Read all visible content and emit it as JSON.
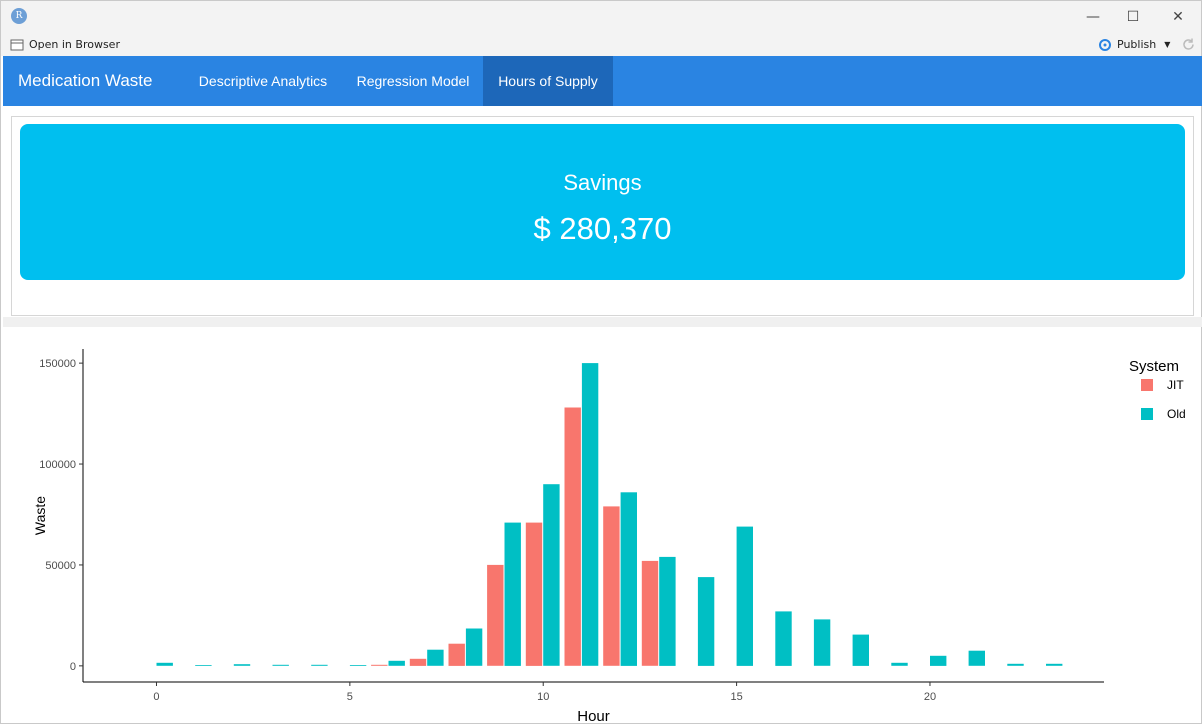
{
  "window": {
    "app_icon": "R",
    "controls": {
      "minimize": "—",
      "maximize": "☐",
      "close": "✕"
    }
  },
  "toolbar": {
    "open_in_browser": "Open in Browser",
    "publish": "Publish"
  },
  "navbar": {
    "brand": "Medication Waste",
    "tabs": [
      {
        "label": "Descriptive Analytics",
        "active": false
      },
      {
        "label": "Regression Model",
        "active": false
      },
      {
        "label": "Hours of Supply",
        "active": true
      }
    ]
  },
  "valuebox": {
    "title": "Savings",
    "value": "$ 280,370",
    "color": "#00bfef"
  },
  "colors": {
    "navbar": "#2a84e2",
    "active_tab": "#1d67b9",
    "jit": "#f8766d",
    "old": "#00bfc4"
  },
  "chart_data": {
    "type": "bar",
    "xlabel": "Hour",
    "ylabel": "Waste",
    "xlim": [
      -1.9,
      24.5
    ],
    "ylim": [
      -8000,
      157000
    ],
    "xticks": [
      0,
      5,
      10,
      15,
      20
    ],
    "yticks": [
      0,
      50000,
      100000,
      150000
    ],
    "ytick_labels": [
      "0",
      "50000",
      "100000",
      "150000"
    ],
    "legend": {
      "title": "System",
      "placement": "right"
    },
    "x": [
      0,
      1,
      2,
      3,
      4,
      5,
      6,
      7,
      8,
      9,
      10,
      11,
      12,
      13,
      14,
      15,
      16,
      17,
      18,
      19,
      20,
      21,
      22,
      23
    ],
    "series": [
      {
        "name": "JIT",
        "color": "#f8766d",
        "values": [
          0,
          0,
          0,
          0,
          0,
          0,
          500,
          3500,
          11000,
          50000,
          71000,
          128000,
          79000,
          52000,
          0,
          0,
          0,
          0,
          0,
          0,
          0,
          0,
          0,
          0
        ]
      },
      {
        "name": "Old",
        "color": "#00bfc4",
        "values": [
          1500,
          400,
          800,
          500,
          500,
          400,
          2500,
          8000,
          18500,
          71000,
          90000,
          150000,
          86000,
          54000,
          44000,
          69000,
          27000,
          23000,
          15500,
          1500,
          5000,
          7500,
          1000,
          1000
        ]
      }
    ]
  }
}
